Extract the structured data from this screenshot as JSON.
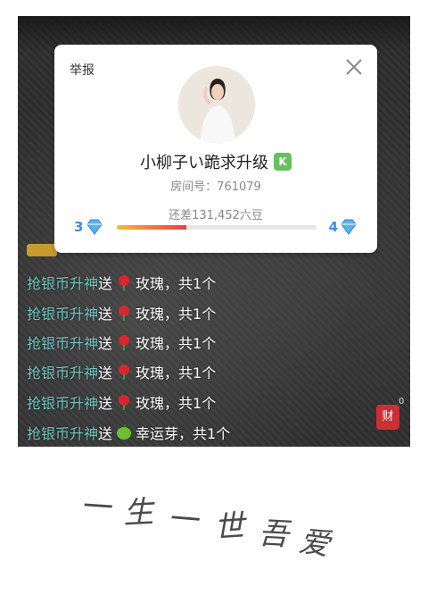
{
  "popup": {
    "report_label": "举报",
    "close_icon": "close-icon",
    "nickname": "小柳子い跪求升级",
    "level_badge": "K",
    "room_label": "房间号：761079",
    "remaining_text": "还差131,452六豆",
    "level_current": "3",
    "level_next": "4",
    "progress_fraction": 0.35,
    "colors": {
      "accent": "#3a8ee6",
      "badge": "#67c15e"
    }
  },
  "chat": [
    {
      "user": "抢银币升神",
      "verb": "送",
      "gift_icon": "rose-icon",
      "gift": "玫瑰，共1个"
    },
    {
      "user": "抢银币升神",
      "verb": "送",
      "gift_icon": "rose-icon",
      "gift": "玫瑰，共1个"
    },
    {
      "user": "抢银币升神",
      "verb": "送",
      "gift_icon": "rose-icon",
      "gift": "玫瑰，共1个"
    },
    {
      "user": "抢银币升神",
      "verb": "送",
      "gift_icon": "rose-icon",
      "gift": "玫瑰，共1个"
    },
    {
      "user": "抢银币升神",
      "verb": "送",
      "gift_icon": "rose-icon",
      "gift": "玫瑰，共1个"
    },
    {
      "user": "抢银币升神",
      "verb": "送",
      "gift_icon": "lucky-sprout-icon",
      "gift": "幸运芽，共1个"
    }
  ],
  "fortune_button": {
    "label": "财",
    "count": "0"
  },
  "caption": "一生一世吾爱"
}
